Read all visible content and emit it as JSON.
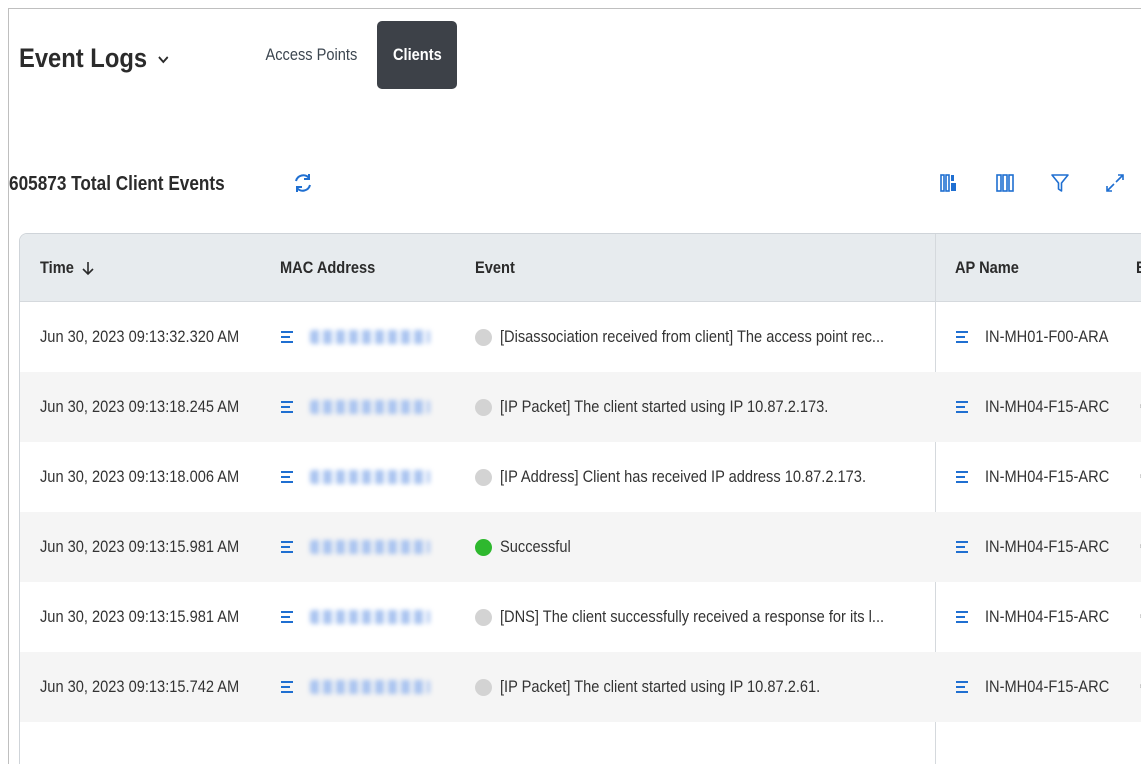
{
  "header": {
    "title": "Event Logs",
    "tabs": [
      {
        "label": "Access Points",
        "active": false
      },
      {
        "label": "Clients",
        "active": true
      }
    ]
  },
  "toolbar": {
    "total_events": "605873 Total Client Events",
    "icons": [
      "refresh-icon",
      "column-settings-icon",
      "columns-icon",
      "filter-icon",
      "expand-icon"
    ]
  },
  "table": {
    "columns": {
      "time": "Time",
      "mac": "MAC Address",
      "event": "Event",
      "ap_name": "AP Name",
      "extra": "E"
    },
    "sort": {
      "column": "time",
      "direction": "descending"
    },
    "rows": [
      {
        "time": "Jun 30, 2023 09:13:32.320 AM",
        "mac_redacted": true,
        "status": "neutral",
        "event": "[Disassociation received from client] The access point rec...",
        "ap_name": "IN-MH01-F00-ARA",
        "extra": ""
      },
      {
        "time": "Jun 30, 2023 09:13:18.245 AM",
        "mac_redacted": true,
        "status": "neutral",
        "event": "[IP Packet] The client started using IP 10.87.2.173.",
        "ap_name": "IN-MH04-F15-ARC",
        "extra": "€"
      },
      {
        "time": "Jun 30, 2023 09:13:18.006 AM",
        "mac_redacted": true,
        "status": "neutral",
        "event": "[IP Address] Client has received IP address 10.87.2.173.",
        "ap_name": "IN-MH04-F15-ARC",
        "extra": "€"
      },
      {
        "time": "Jun 30, 2023 09:13:15.981 AM",
        "mac_redacted": true,
        "status": "success",
        "event": "Successful",
        "ap_name": "IN-MH04-F15-ARC",
        "extra": "€"
      },
      {
        "time": "Jun 30, 2023 09:13:15.981 AM",
        "mac_redacted": true,
        "status": "neutral",
        "event": "[DNS] The client successfully received a response for its l...",
        "ap_name": "IN-MH04-F15-ARC",
        "extra": "€"
      },
      {
        "time": "Jun 30, 2023 09:13:15.742 AM",
        "mac_redacted": true,
        "status": "neutral",
        "event": "[IP Packet] The client started using IP 10.87.2.61.",
        "ap_name": "IN-MH04-F15-ARC",
        "extra": "€"
      }
    ]
  },
  "colors": {
    "accent": "#1f6fd1",
    "tab_active_bg": "#3d4148",
    "header_bg": "#e7ebee",
    "row_alt_bg": "#f5f5f5",
    "status_success": "#2eb82e",
    "status_neutral": "#d3d3d3",
    "mac_blur": "#aac4f0"
  }
}
